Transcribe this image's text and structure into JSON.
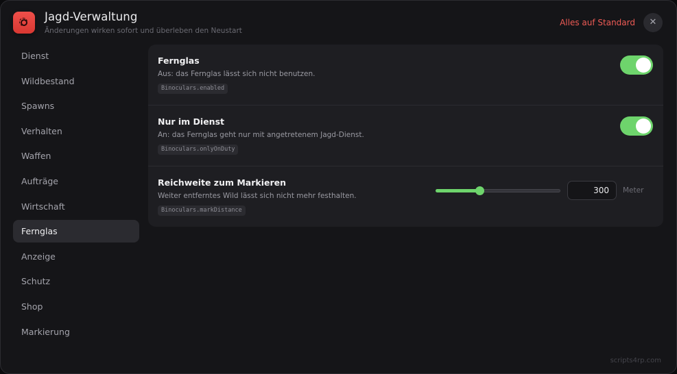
{
  "header": {
    "title": "Jagd-Verwaltung",
    "subtitle": "Änderungen wirken sofort und überleben den Neustart",
    "icon": "gear-icon",
    "reset_label": "Alles auf Standard",
    "close_glyph": "✕"
  },
  "sidebar": {
    "active": "Fernglas",
    "items": [
      "Dienst",
      "Wildbestand",
      "Spawns",
      "Verhalten",
      "Waffen",
      "Aufträge",
      "Wirtschaft",
      "Fernglas",
      "Anzeige",
      "Schutz",
      "Shop",
      "Markierung"
    ]
  },
  "settings": [
    {
      "title": "Fernglas",
      "description": "Aus: das Fernglas lässt sich nicht benutzen.",
      "key": "Binoculars.enabled",
      "control": "toggle",
      "enabled": true
    },
    {
      "title": "Nur im Dienst",
      "description": "An: das Fernglas geht nur mit angetretenem Jagd-Dienst.",
      "key": "Binoculars.onlyOnDuty",
      "control": "toggle",
      "enabled": true
    },
    {
      "title": "Reichweite zum Markieren",
      "description": "Weiter entferntes Wild lässt sich nicht mehr festhalten.",
      "key": "Binoculars.markDistance",
      "control": "slider",
      "value": "300",
      "unit": "Meter",
      "slider_fraction": 0.35
    }
  ],
  "footer": {
    "watermark": "scripts4rp.com"
  },
  "colors": {
    "accent_green": "#6ed46c",
    "accent_red": "#ee5b55",
    "window_bg": "#151518",
    "panel_bg": "#1e1e22"
  }
}
